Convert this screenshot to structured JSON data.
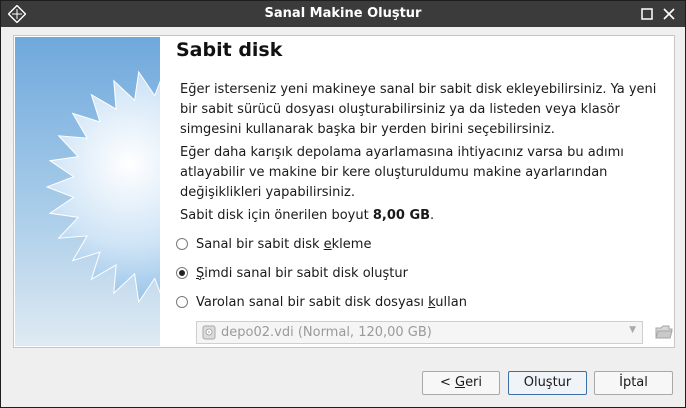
{
  "window": {
    "title": "Sanal Makine Oluştur",
    "controls": [
      "restore-icon",
      "close-icon"
    ]
  },
  "page": {
    "heading": "Sabit disk",
    "paragraph1": "Eğer isterseniz yeni makineye sanal bir sabit disk ekleyebilirsiniz. Ya yeni bir sabit sürücü dosyası oluşturabilirsiniz ya da listeden veya klasör simgesini kullanarak başka bir yerden birini seçebilirsiniz.",
    "paragraph2": "Eğer daha karışık depolama ayarlamasına ihtiyacınız varsa bu adımı atlayabilir ve makine bir kere oluşturuldumu makine ayarlarından değişiklikleri yapabilirsiniz.",
    "recommended_prefix": "Sabit disk için önerilen boyut ",
    "recommended_size": "8,00 GB",
    "recommended_suffix": "."
  },
  "options": [
    {
      "pre": "Sanal bir sabit disk ",
      "ul": "e",
      "post": "kleme",
      "checked": false
    },
    {
      "pre": "",
      "ul": "Ş",
      "post": "imdi sanal bir sabit disk oluştur",
      "checked": true
    },
    {
      "pre": "Varolan sanal bir sabit disk dosyası ",
      "ul": "k",
      "post": "ullan",
      "checked": false
    }
  ],
  "existing_disk": {
    "value": "depo02.vdi (Normal, 120,00 GB)",
    "icon": "hard-disk-icon",
    "enabled": false
  },
  "buttons": {
    "back_pre": "< ",
    "back_ul": "G",
    "back_post": "eri",
    "create": "Oluştur",
    "cancel": "İptal"
  },
  "colors": {
    "titlebar": "#3b3b3b",
    "sidebar_top": "#6fa8dc",
    "default_button_border": "#3c6ea8"
  }
}
